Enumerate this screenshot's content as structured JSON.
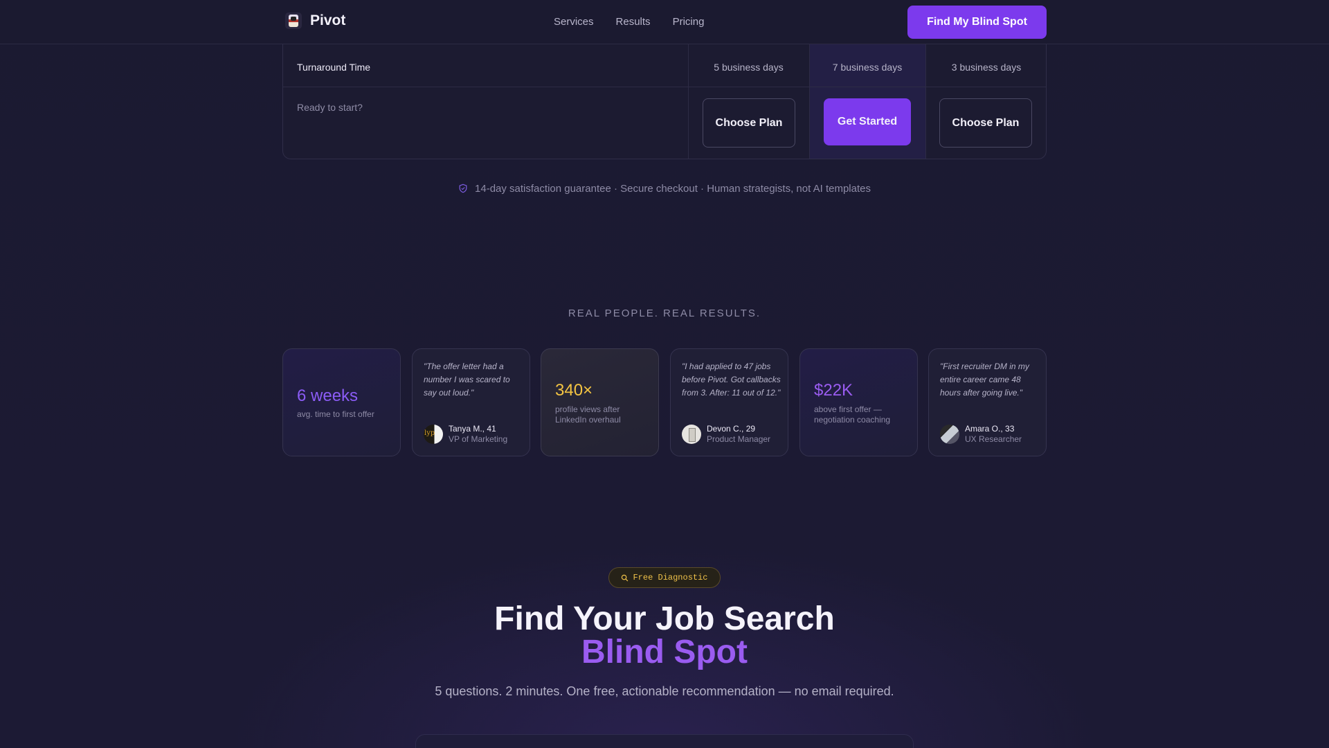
{
  "header": {
    "brand": "Pivot",
    "nav": [
      "Services",
      "Results",
      "Pricing"
    ],
    "cta": "Find My Blind Spot"
  },
  "table": {
    "row_label": "Turnaround Time",
    "turnaround": [
      "5 business days",
      "7 business days",
      "3 business days"
    ],
    "ready_label": "Ready to start?",
    "buttons": [
      "Choose Plan",
      "Get Started",
      "Choose Plan"
    ]
  },
  "guarantee": "14-day satisfaction guarantee · Secure checkout · Human strategists, not AI templates",
  "results": {
    "kicker": "REAL PEOPLE. REAL RESULTS.",
    "cards": [
      {
        "type": "stat",
        "value": "6 weeks",
        "label": "avg. time to first offer",
        "color": "#8b5cf6"
      },
      {
        "type": "quote",
        "quote": "\"The offer letter had a number I was scared to say out loud.\"",
        "name": "Tanya M., 41",
        "role": "VP of Marketing"
      },
      {
        "type": "stat",
        "value": "340×",
        "label": "profile views after LinkedIn overhaul",
        "color": "#f5c542"
      },
      {
        "type": "quote",
        "quote": "\"I had applied to 47 jobs before Pivot. Got callbacks from 3. After: 11 out of 12.\"",
        "name": "Devon C., 29",
        "role": "Product Manager"
      },
      {
        "type": "stat",
        "value": "$22K",
        "label": "above first offer — negotiation coaching",
        "color": "#9a5cf0"
      },
      {
        "type": "quote",
        "quote": "\"First recruiter DM in my entire career came 48 hours after going live.\"",
        "name": "Amara O., 33",
        "role": "UX Researcher"
      }
    ]
  },
  "diagnostic": {
    "pill": "Free Diagnostic",
    "title_line1": "Find Your Job Search",
    "title_line2": "Blind Spot",
    "subtitle": "5 questions. 2 minutes. One free, actionable recommendation — no email required."
  }
}
